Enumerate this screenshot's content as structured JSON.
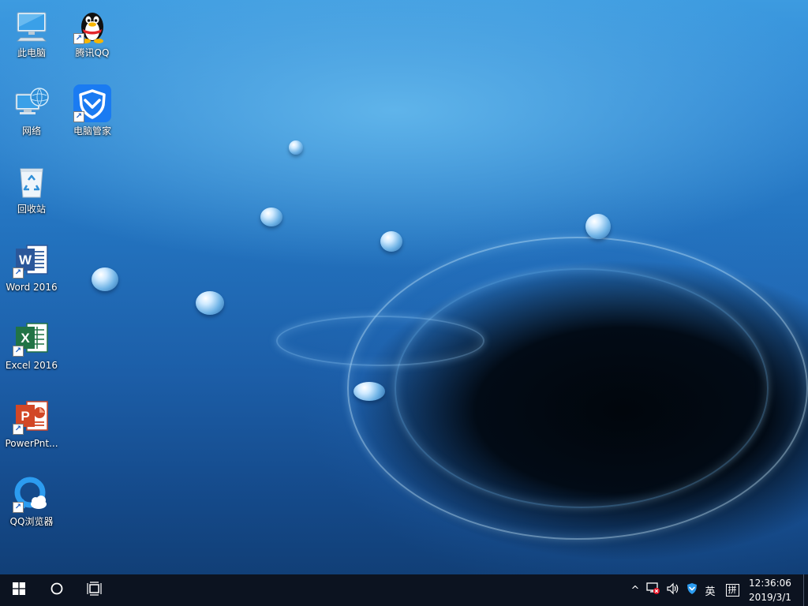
{
  "desktop": {
    "icons": [
      {
        "label": "此电脑",
        "icon": "this-pc-icon"
      },
      {
        "label": "腾讯QQ",
        "icon": "qq-penguin-icon"
      },
      {
        "label": "网络",
        "icon": "network-icon"
      },
      {
        "label": "电脑管家",
        "icon": "pc-manager-icon"
      },
      {
        "label": "回收站",
        "icon": "recycle-bin-icon"
      },
      {
        "label": "Word 2016",
        "icon": "word-icon"
      },
      {
        "label": "Excel 2016",
        "icon": "excel-icon"
      },
      {
        "label": "PowerPnt...",
        "icon": "powerpoint-icon"
      },
      {
        "label": "QQ浏览器",
        "icon": "qq-browser-icon"
      }
    ],
    "colors": {
      "wallpaper_top": "#3d9be0",
      "wallpaper_bottom": "#113f77",
      "taskbar": "#0c1320",
      "word": "#2b579a",
      "excel": "#217346",
      "powerpoint": "#d24726",
      "pc_manager": "#1a7bf2"
    }
  },
  "taskbar": {
    "start": "start-windows-icon",
    "search": "search-circle-icon",
    "task_view": "task-view-icon",
    "tray": {
      "chevron": "^",
      "network": "network-disconnected-icon",
      "volume": "volume-icon",
      "pc_manager": "pc-manager-tray-icon",
      "ime_lang": "英",
      "ime_mode": "拼"
    },
    "clock": {
      "time": "12:36:06",
      "date": "2019/3/1"
    }
  }
}
